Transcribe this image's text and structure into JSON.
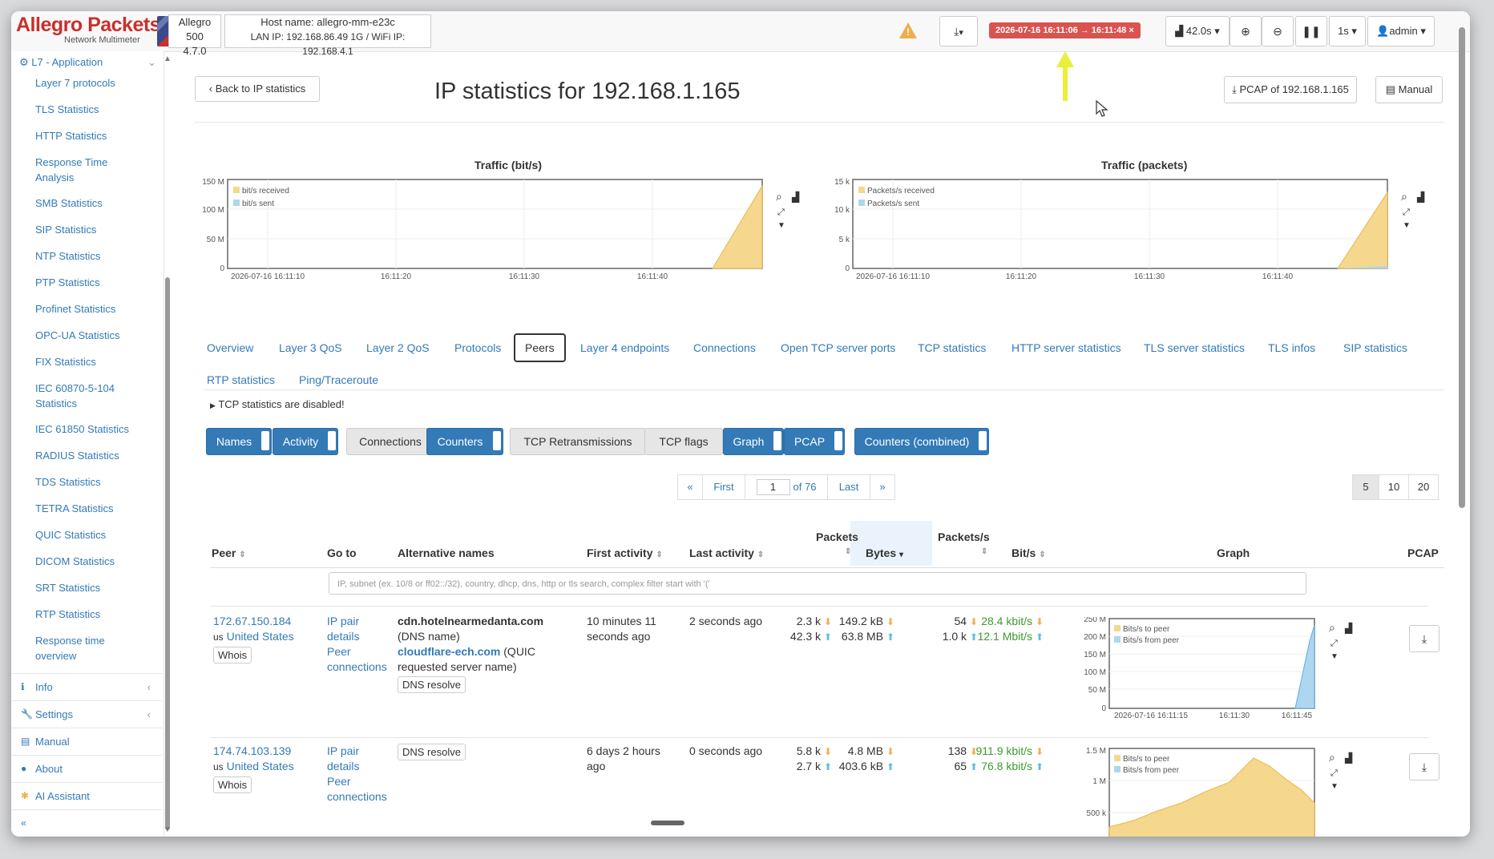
{
  "header": {
    "logo_title": "Allegro Packets",
    "logo_sub": "Network Multimeter",
    "device_model": "Allegro 500",
    "device_version": "4.7.0",
    "host_line": "Host name: allegro-mm-e23c",
    "ip_line": "LAN IP: 192.168.86.49 1G / WiFi IP: 192.168.4.1",
    "time_range": "2026-07-16 16:11:06 → 16:11:48 ×",
    "interval_label": "42.0s ▾",
    "step_label": "1s ▾",
    "user_label": "admin ▾",
    "download_label": "▾"
  },
  "sidebar": {
    "section_title": "L7 - Application",
    "items": [
      "Layer 7 protocols",
      "TLS Statistics",
      "HTTP Statistics",
      "Response Time Analysis",
      "SMB Statistics",
      "SIP Statistics",
      "NTP Statistics",
      "PTP Statistics",
      "Profinet Statistics",
      "OPC-UA Statistics",
      "FIX Statistics",
      "IEC 60870-5-104 Statistics",
      "IEC 61850 Statistics",
      "RADIUS Statistics",
      "TDS Statistics",
      "TETRA Statistics",
      "QUIC Statistics",
      "DICOM Statistics",
      "SRT Statistics",
      "RTP Statistics",
      "Response time overview"
    ],
    "sections": [
      "Info",
      "Settings",
      "Manual",
      "About",
      "AI Assistant"
    ],
    "collapse": "«"
  },
  "page": {
    "back_label": "Back to IP statistics",
    "title": "IP statistics for 192.168.1.165",
    "pcap_label": "PCAP of 192.168.1.165",
    "manual_label": "Manual"
  },
  "charts": {
    "bits": {
      "title": "Traffic (bit/s)",
      "legend": [
        "bit/s received",
        "bit/s sent"
      ],
      "yticks": [
        "150 M",
        "100 M",
        "50 M",
        "0"
      ],
      "xticks": [
        "2026-07-16 16:11:10",
        "16:11:20",
        "16:11:30",
        "16:11:40"
      ]
    },
    "packets": {
      "title": "Traffic (packets)",
      "legend": [
        "Packets/s received",
        "Packets/s sent"
      ],
      "yticks": [
        "15 k",
        "10 k",
        "5 k",
        "0"
      ],
      "xticks": [
        "2026-07-16 16:11:10",
        "16:11:20",
        "16:11:30",
        "16:11:40"
      ]
    }
  },
  "tabs": {
    "row1": [
      "Overview",
      "Layer 3 QoS",
      "Layer 2 QoS",
      "Protocols",
      "Peers",
      "Layer 4 endpoints",
      "Connections",
      "Open TCP server ports",
      "TCP statistics",
      "HTTP server statistics",
      "TLS server statistics",
      "TLS infos",
      "SIP statistics"
    ],
    "row2": [
      "RTP statistics",
      "Ping/Traceroute"
    ]
  },
  "note": "TCP statistics are disabled!",
  "toggles": [
    "Names",
    "Activity",
    "Connections",
    "Counters",
    "TCP Retransmissions",
    "TCP flags",
    "Graph",
    "PCAP",
    "Counters (combined)"
  ],
  "pager": {
    "prev": "«",
    "first": "First",
    "page": "1",
    "of": "of 76",
    "last": "Last",
    "next": "»",
    "sizes": [
      "5",
      "10",
      "20"
    ]
  },
  "table": {
    "headers": {
      "peer": "Peer",
      "goto": "Go to",
      "alt": "Alternative names",
      "first": "First activity",
      "last": "Last activity",
      "packets": "Packets",
      "bytes": "Bytes",
      "pps": "Packets/s",
      "bits": "Bit/s",
      "graph": "Graph",
      "pcap": "PCAP"
    },
    "sort_icon": "⇕",
    "sort_desc": "▾",
    "filter_placeholder": "IP, subnet (ex. 10/8 or ff02::/32), country, dhcp, dns, http or tls search, complex filter start with '('",
    "rows": [
      {
        "ip": "172.67.150.184",
        "country_code": "us",
        "country": "United States",
        "whois": "Whois",
        "goto1": "IP pair details",
        "goto2": "Peer connections",
        "alt1_name": "cdn.hotelnearmedanta.com",
        "alt1_src": " (DNS name)",
        "alt2_name": "cloudflare-ech.com",
        "alt2_src": " (QUIC requested server name)",
        "dns": "DNS resolve",
        "first": "10 minutes 11 seconds ago",
        "last": "2 seconds ago",
        "pk_rx": "2.3 k",
        "pk_tx": "42.3 k",
        "by_rx": "149.2 kB",
        "by_tx": "63.8 MB",
        "pps_rx": "54",
        "pps_tx": "1.0 k",
        "bit_rx": "28.4 kbit/s",
        "bit_tx": "12.1 Mbit/s",
        "graph_legend": [
          "Bits/s to peer",
          "Bits/s from peer"
        ],
        "graph_yticks": [
          "250 M",
          "200 M",
          "150 M",
          "100 M",
          "50 M",
          "0"
        ],
        "graph_xticks": [
          "2026-07-16 16:11:15",
          "16:11:30",
          "16:11:45"
        ]
      },
      {
        "ip": "174.74.103.139",
        "country_code": "us",
        "country": "United States",
        "whois": "Whois",
        "goto1": "IP pair details",
        "goto2": "Peer connections",
        "dns": "DNS resolve",
        "first": "6 days 2 hours ago",
        "last": "0 seconds ago",
        "pk_rx": "5.8 k",
        "pk_tx": "2.7 k",
        "by_rx": "4.8 MB",
        "by_tx": "403.6 kB",
        "pps_rx": "138",
        "pps_tx": "65",
        "bit_rx": "911.9 kbit/s",
        "bit_tx": "76.8 kbit/s",
        "graph_legend": [
          "Bits/s to peer",
          "Bits/s from peer"
        ],
        "graph_yticks": [
          "1.5 M",
          "1 M",
          "500 k"
        ]
      }
    ]
  },
  "colors": {
    "brand": "#c9302c",
    "link": "#337ab7",
    "received": "#f5d78e",
    "sent": "#aed6f1",
    "good": "#3c9a2e"
  }
}
